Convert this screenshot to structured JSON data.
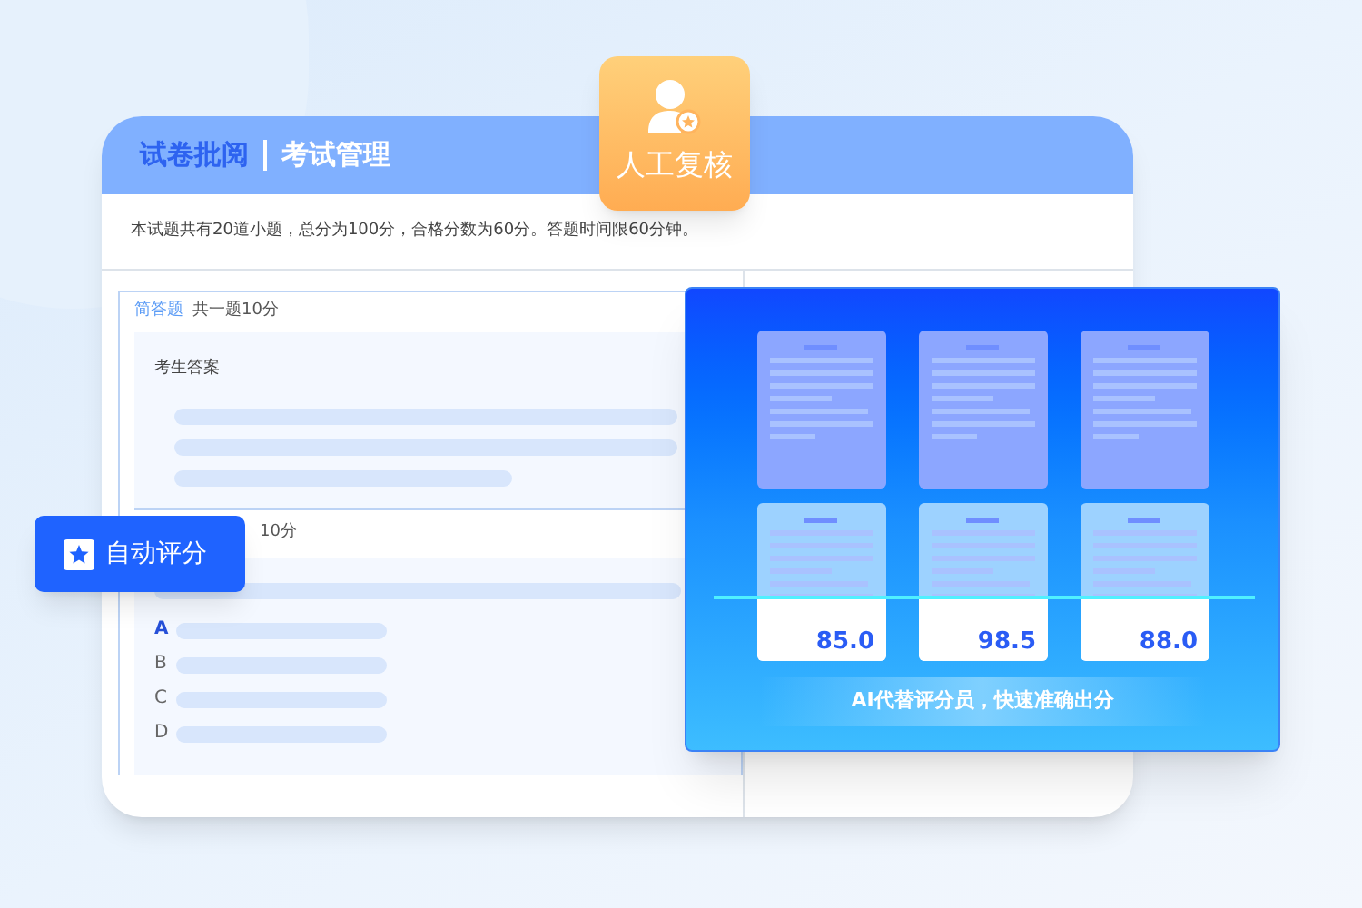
{
  "tabs": [
    {
      "label": "试卷批阅",
      "selected": true
    },
    {
      "label": "考试管理",
      "selected": false
    }
  ],
  "notice": "本试题共有20道小题，总分为100分，合格分数为60分。答题时间限60分钟。",
  "essay_section": {
    "type_label": "简答题",
    "meta": "共一题10分",
    "answer_label": "考生答案"
  },
  "choice_section": {
    "meta": "10分",
    "options": [
      {
        "letter": "A",
        "selected": true
      },
      {
        "letter": "B",
        "selected": false
      },
      {
        "letter": "C",
        "selected": false
      },
      {
        "letter": "D",
        "selected": false
      }
    ]
  },
  "manual_review_badge": {
    "label": "人工复核"
  },
  "auto_score_badge": {
    "label": "自动评分"
  },
  "ai_panel": {
    "scores": [
      "85.0",
      "98.5",
      "88.0"
    ],
    "caption": "AI代替评分员，快速准确出分"
  }
}
